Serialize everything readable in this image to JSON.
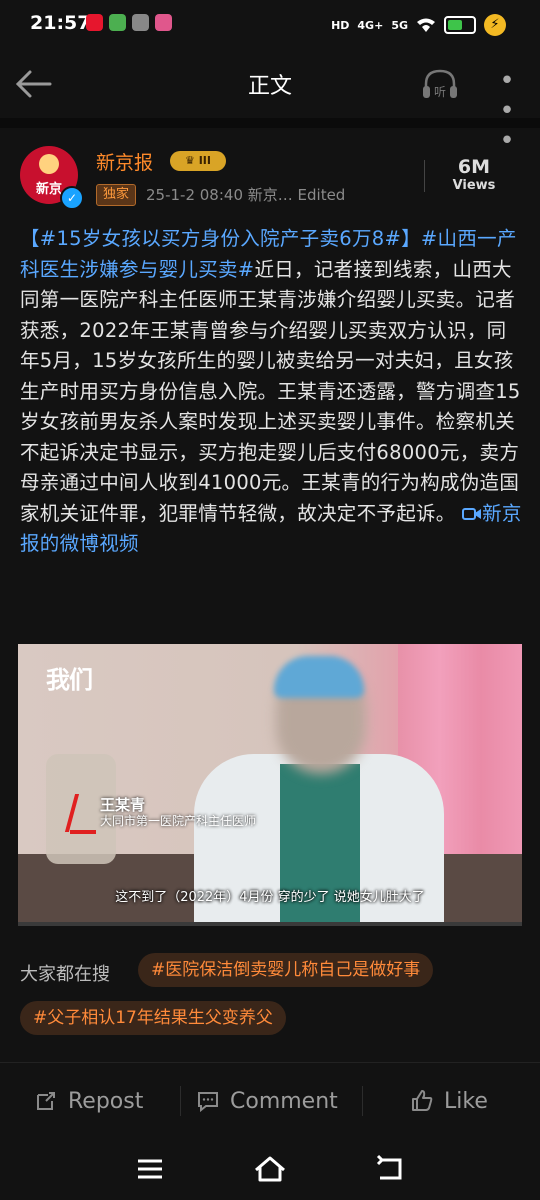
{
  "status_bar": {
    "time": "21:57",
    "signal_4g": "4G+",
    "signal_5g": "5G",
    "hd_label": "HD",
    "notif_icons": [
      "weibo-icon",
      "wechat-icon",
      "keyhole-icon",
      "app-icon"
    ],
    "colors": {
      "weibo": "#e6162d",
      "wechat": "#4caf50",
      "app": "#e0578c"
    }
  },
  "nav": {
    "title": "正文",
    "back_icon": "back-arrow-icon",
    "listen_label": "听",
    "more_icon": "more-icon"
  },
  "post": {
    "avatar_text": "新京",
    "user_name": "新京报",
    "level_badge": "III",
    "exclusive_tag": "独家",
    "meta": "25-1-2 08:40  新京…  Edited",
    "views_count": "6M",
    "views_label": "Views",
    "text": {
      "topic1": "【#15岁女孩以买方身份入院产子卖6万8#】",
      "topic2": "#山西一产科医生涉嫌参与婴儿买卖#",
      "body": "近日，记者接到线索，山西大同第一医院产科主任医师王某青涉嫌介绍婴儿买卖。记者获悉，2022年王某青曾参与介绍婴儿买卖双方认识，同年5月，15岁女孩所生的婴儿被卖给另一对夫妇，且女孩生产时用买方身份信息入院。王某青还透露，警方调查15岁女孩前男友杀人案时发现上述买卖婴儿事件。检察机关不起诉决定书显示，买方抱走婴儿后支付68000元，卖方母亲通过中间人收到41000元。王某青的行为构成伪造国家机关证件罪，犯罪情节轻微，故决定不予起诉。",
      "video_link": "新京报的微博视频"
    },
    "video": {
      "logo": "我们",
      "person_name": "王某青",
      "person_role": "大同市第一医院产科主任医师",
      "caption": "这不到了（2022年）4月份 穿的少了 说她女儿肚大了",
      "progress": 0.0
    }
  },
  "search": {
    "label": "大家都在搜",
    "chips": [
      "#医院保洁倒卖婴儿称自己是做好事",
      "#父子相认17年结果生父变养父"
    ]
  },
  "actions": {
    "repost": "Repost",
    "comment": "Comment",
    "like": "Like"
  }
}
